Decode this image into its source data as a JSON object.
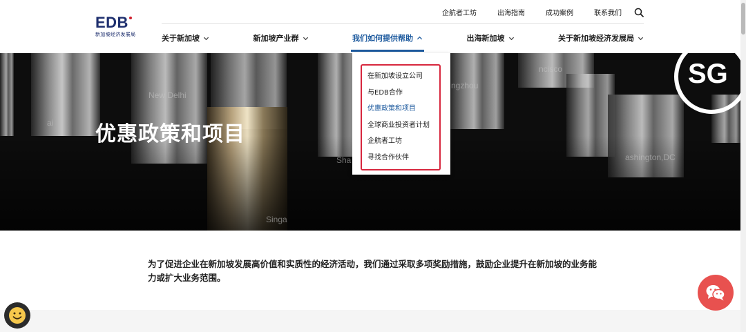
{
  "logo": {
    "text": "EDB",
    "subtitle": "新加坡经济发展局"
  },
  "util_nav": [
    "企航者工坊",
    "出海指南",
    "成功案例",
    "联系我们"
  ],
  "main_nav": [
    {
      "label": "关于新加坡",
      "active": false
    },
    {
      "label": "新加坡产业群",
      "active": false
    },
    {
      "label": "我们如何提供帮助",
      "active": true
    },
    {
      "label": "出海新加坡",
      "active": false
    },
    {
      "label": "关于新加坡经济发展局",
      "active": false
    }
  ],
  "dropdown": [
    {
      "label": "在新加坡设立公司",
      "active": false
    },
    {
      "label": "与EDB合作",
      "active": false
    },
    {
      "label": "优惠政策和项目",
      "active": true
    },
    {
      "label": "全球商业投资者计划",
      "active": false
    },
    {
      "label": "企航者工坊",
      "active": false
    },
    {
      "label": "寻找合作伙伴",
      "active": false
    }
  ],
  "hero": {
    "title": "优惠政策和项目",
    "badge": "SG",
    "city_labels": [
      "New Delhi",
      "ngzhou",
      "ncisco",
      "ashington,DC",
      "Singa",
      "Sha",
      "ai"
    ]
  },
  "intro": "为了促进企业在新加坡发展高价值和实质性的经济活动，我们通过采取多项奖励措施，鼓励企业提升在新加坡的业务能力或扩大业务范围。",
  "colors": {
    "brand": "#1e2f6e",
    "accent": "#1d5a9e",
    "highlight": "#d7263d",
    "wechat": "#e8514f"
  },
  "icons": {
    "search": "search-icon",
    "wechat": "wechat-icon",
    "assistant": "smiley-icon",
    "chevron": "chevron-down-icon"
  }
}
